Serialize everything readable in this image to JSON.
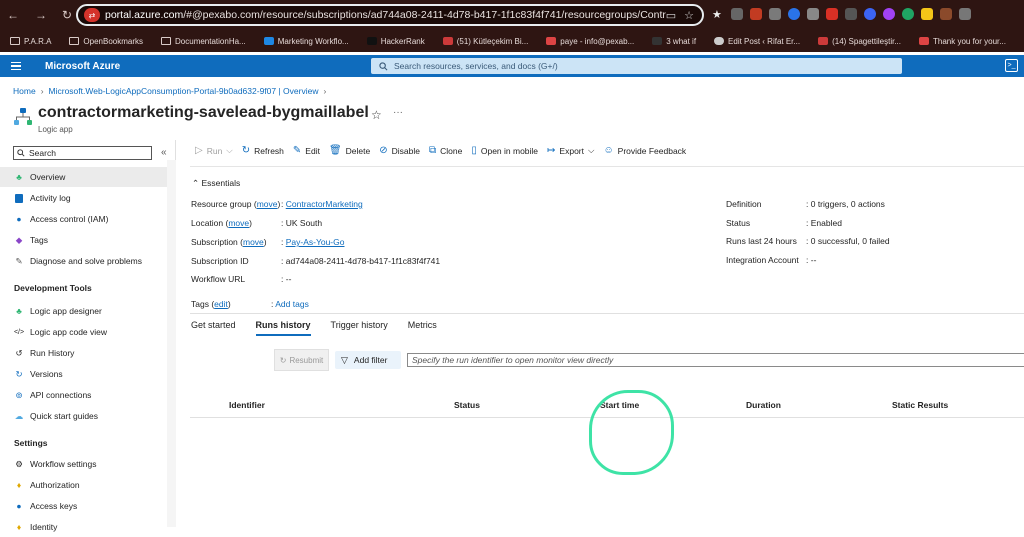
{
  "browser": {
    "url_prefix": "portal.azure.com",
    "url_rest": "/#@pexabo.com/resource/subscriptions/ad744a08-2411-4d78-b417-1f1c83f4f741/resourcegroups/Contract...",
    "bookmarks": [
      "P.A.R.A",
      "OpenBookmarks",
      "DocumentationHa...",
      "Marketing Workflo...",
      "HackerRank",
      "(51) Kütleçekim Bi...",
      "paye - info@pexab...",
      "3 what if",
      "Edit Post ‹ Rifat Er...",
      "(14) Spagettileştir...",
      "Thank you for your..."
    ]
  },
  "portal": {
    "brand": "Microsoft Azure",
    "search_placeholder": "Search resources, services, and docs (G+/)"
  },
  "breadcrumb": [
    "Home",
    "Microsoft.Web-LogicAppConsumption-Portal-9b0ad632-9f07 | Overview"
  ],
  "resource": {
    "title": "contractormarketing-savelead-bygmaillabel",
    "type": "Logic app"
  },
  "sidebar": {
    "search_placeholder": "Search",
    "items": [
      "Overview",
      "Activity log",
      "Access control (IAM)",
      "Tags",
      "Diagnose and solve problems"
    ],
    "dev_header": "Development Tools",
    "dev_items": [
      "Logic app designer",
      "Logic app code view",
      "Run History",
      "Versions",
      "API connections",
      "Quick start guides"
    ],
    "settings_header": "Settings",
    "settings_items": [
      "Workflow settings",
      "Authorization",
      "Access keys",
      "Identity"
    ]
  },
  "toolbar": {
    "run": "Run",
    "refresh": "Refresh",
    "edit": "Edit",
    "delete": "Delete",
    "disable": "Disable",
    "clone": "Clone",
    "open_mobile": "Open in mobile",
    "export": "Export",
    "feedback": "Provide Feedback"
  },
  "essentials": {
    "header": "Essentials",
    "move": "move",
    "rg_key": "Resource group",
    "rg_val": "ContractorMarketing",
    "loc_key": "Location",
    "loc_val": "UK South",
    "sub_key": "Subscription",
    "sub_val": "Pay-As-You-Go",
    "subid_key": "Subscription ID",
    "subid_val": "ad744a08-2411-4d78-b417-1f1c83f4f741",
    "wfurl_key": "Workflow URL",
    "wfurl_val": "--",
    "def_key": "Definition",
    "def_val": "0 triggers, 0 actions",
    "status_key": "Status",
    "status_val": "Enabled",
    "runs_key": "Runs last 24 hours",
    "runs_val": "0 successful, 0 failed",
    "ia_key": "Integration Account",
    "ia_val": "--",
    "tags_key": "Tags",
    "tags_edit": "edit",
    "tags_add": "Add tags"
  },
  "tabs": [
    "Get started",
    "Runs history",
    "Trigger history",
    "Metrics"
  ],
  "runs": {
    "resubmit": "Resubmit",
    "add_filter": "Add filter",
    "run_id_placeholder": "Specify the run identifier to open monitor view directly",
    "columns": [
      "Identifier",
      "Status",
      "Start time",
      "Duration",
      "Static Results"
    ]
  }
}
